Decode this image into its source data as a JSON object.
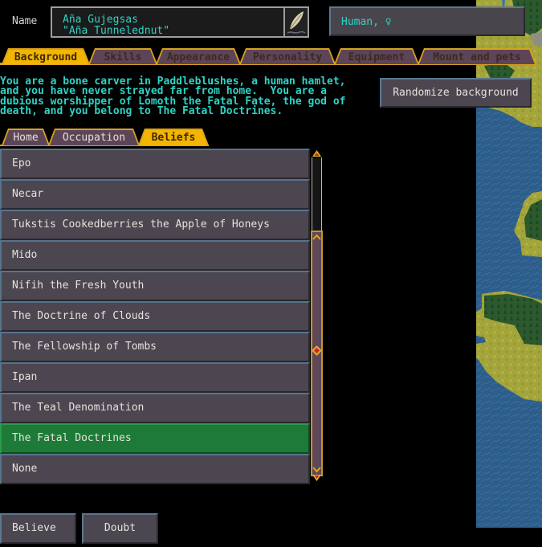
{
  "header": {
    "name_label": "Name",
    "name_line1": "Aña Gujegsas",
    "name_line2": "\"Aña Tunnelednut\"",
    "edit_icon": "quill-icon",
    "race_gender": "Human, ♀"
  },
  "tabs": [
    {
      "label": "Background",
      "active": true
    },
    {
      "label": "Skills",
      "active": false
    },
    {
      "label": "Appearance",
      "active": false
    },
    {
      "label": "Personality",
      "active": false
    },
    {
      "label": "Equipment",
      "active": false
    },
    {
      "label": "Mount and pets",
      "active": false
    }
  ],
  "description": [
    "You are a bone carver in Paddleblushes, a human hamlet,",
    "and you have never strayed far from home.  You are a",
    "dubious worshipper of Lomoth the Fatal Fate, the god of",
    "death, and you belong to The Fatal Doctrines."
  ],
  "randomize_label": "Randomize background",
  "subtabs": [
    {
      "label": "Home",
      "active": false
    },
    {
      "label": "Occupation",
      "active": false
    },
    {
      "label": "Beliefs",
      "active": true
    }
  ],
  "beliefs": {
    "items": [
      "Epo",
      "Necar",
      "Tukstis Cookedberries the Apple of Honeys",
      "Mido",
      "Nifih the Fresh Youth",
      "The Doctrine of Clouds",
      "The Fellowship of Tombs",
      "Ipan",
      "The Teal Denomination",
      "The Fatal Doctrines",
      "None"
    ],
    "selected": "The Fatal Doctrines",
    "scroll_position": 1.0,
    "scroll_visible_fraction": 0.75
  },
  "buttons": {
    "believe": "Believe",
    "doubt": "Doubt"
  },
  "colors": {
    "accent_gold": "#f3b500",
    "tab_inactive": "#5d4558",
    "selected_green": "#1d7b37",
    "text_cyan": "#2fd3c5",
    "panel_gray": "#4b4650"
  }
}
